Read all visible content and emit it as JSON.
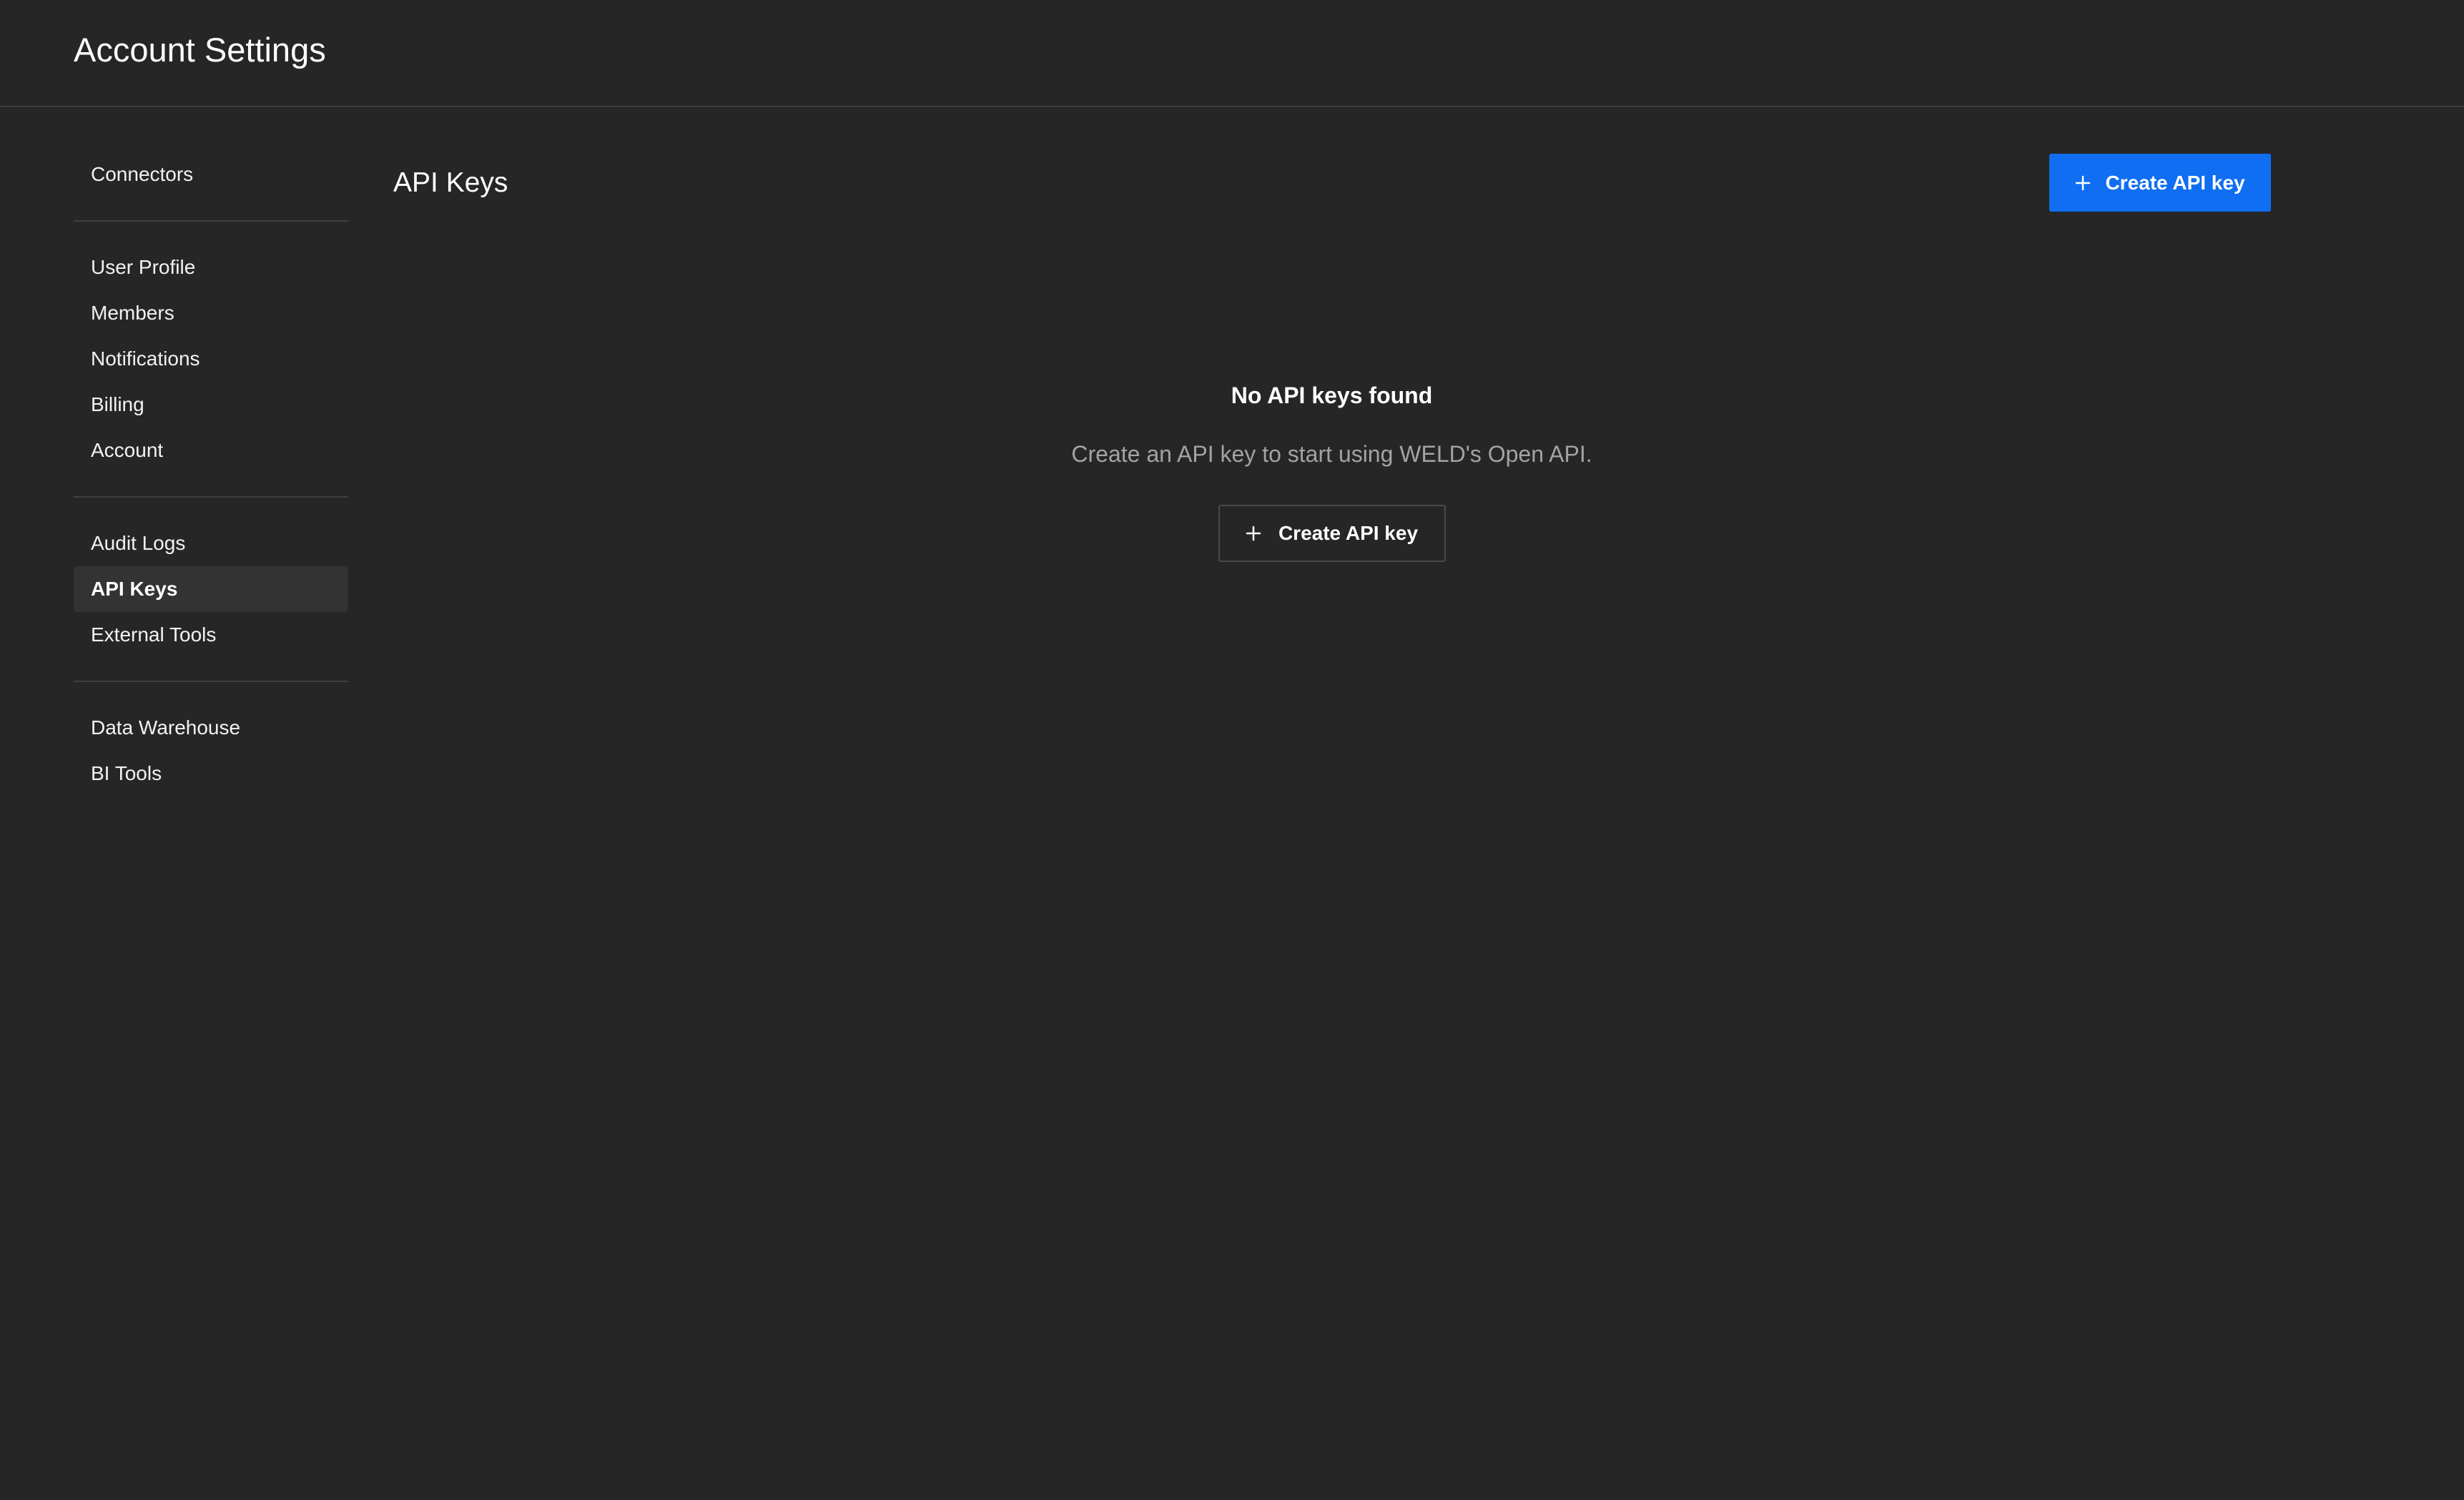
{
  "header": {
    "title": "Account Settings"
  },
  "sidebar": {
    "groups": [
      [
        {
          "label": "Connectors",
          "active": false
        }
      ],
      [
        {
          "label": "User Profile",
          "active": false
        },
        {
          "label": "Members",
          "active": false
        },
        {
          "label": "Notifications",
          "active": false
        },
        {
          "label": "Billing",
          "active": false
        },
        {
          "label": "Account",
          "active": false
        }
      ],
      [
        {
          "label": "Audit Logs",
          "active": false
        },
        {
          "label": "API Keys",
          "active": true
        },
        {
          "label": "External Tools",
          "active": false
        }
      ],
      [
        {
          "label": "Data Warehouse",
          "active": false
        },
        {
          "label": "BI Tools",
          "active": false
        }
      ]
    ]
  },
  "main": {
    "title": "API Keys",
    "create_button_label": "Create API key",
    "empty_state": {
      "title": "No API keys found",
      "description": "Create an API key to start using WELD's Open API.",
      "button_label": "Create API key"
    }
  },
  "icons": {
    "create_primary": "plus-icon",
    "create_secondary": "plus-icon"
  },
  "colors": {
    "background": "#262626",
    "primary_button": "#0f6ef2",
    "active_nav": "#333333",
    "muted_text": "#a3a3a3"
  }
}
